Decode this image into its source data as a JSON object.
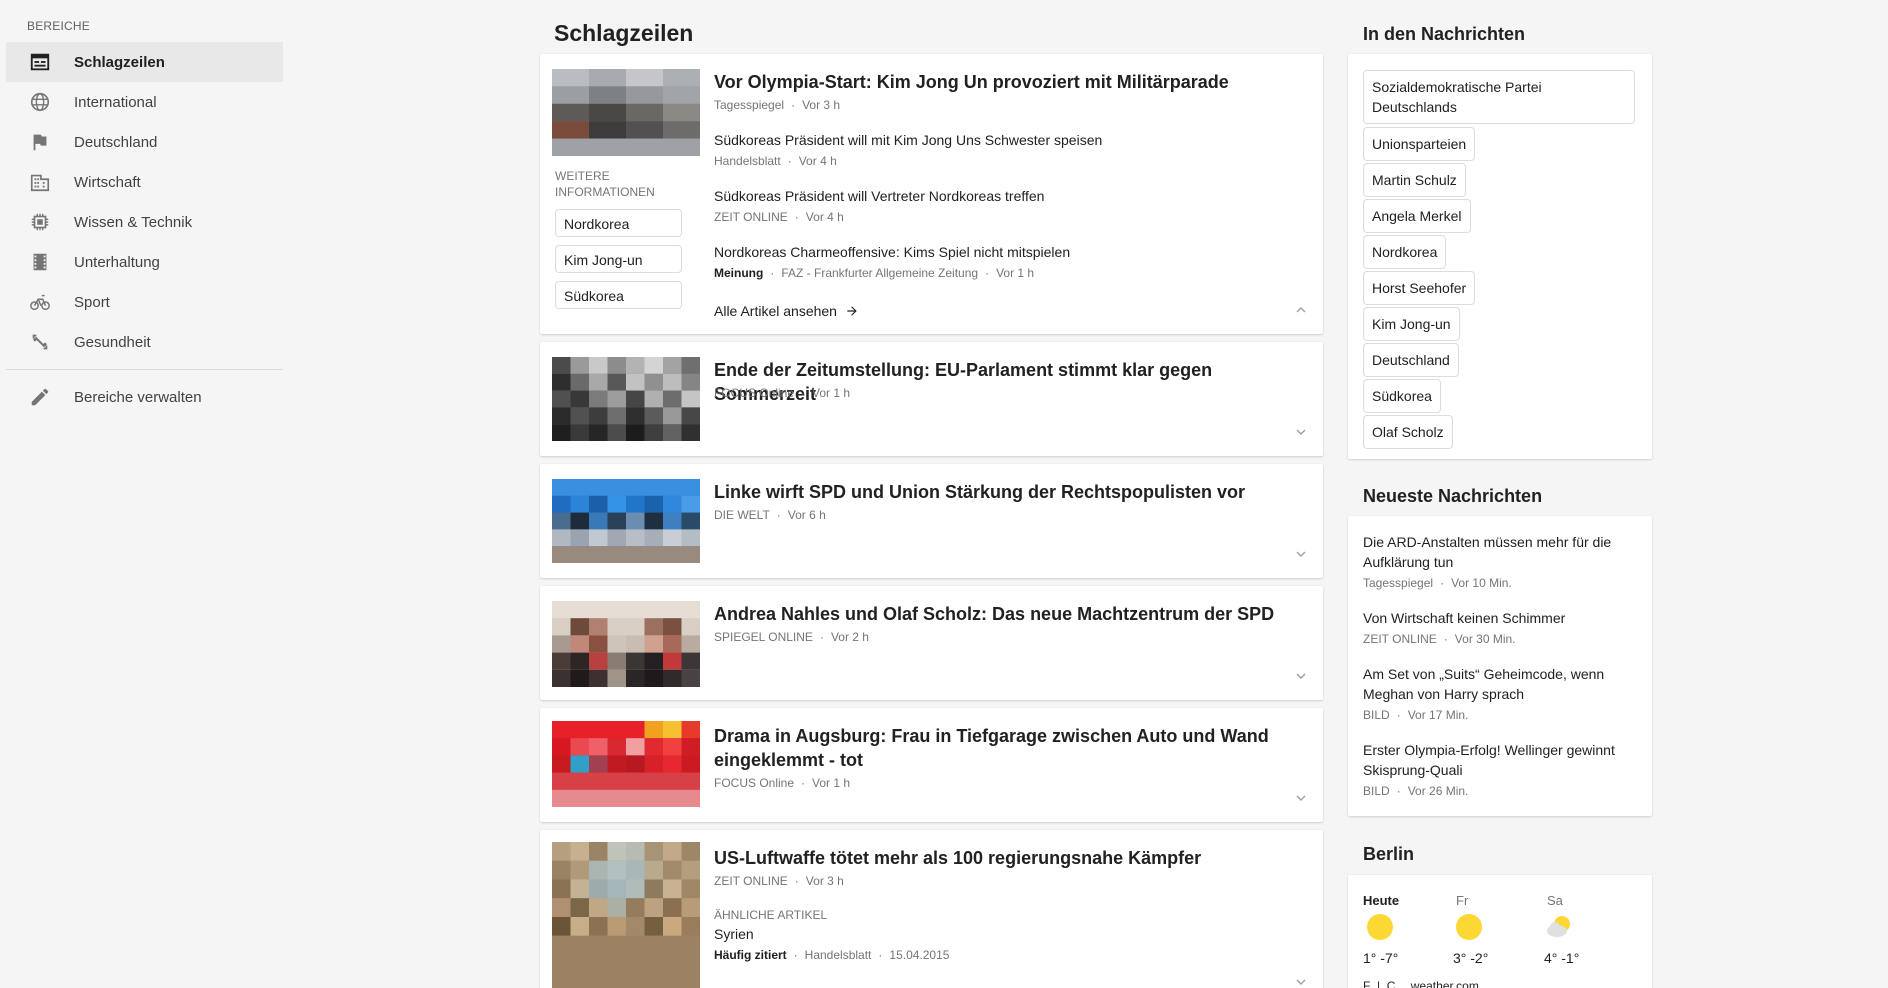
{
  "sidebar": {
    "heading": "BEREICHE",
    "items": [
      {
        "label": "Schlagzeilen",
        "icon": "newspaper-icon"
      },
      {
        "label": "International",
        "icon": "globe-icon"
      },
      {
        "label": "Deutschland",
        "icon": "flag-icon"
      },
      {
        "label": "Wirtschaft",
        "icon": "building-icon"
      },
      {
        "label": "Wissen & Technik",
        "icon": "chip-icon"
      },
      {
        "label": "Unterhaltung",
        "icon": "film-icon"
      },
      {
        "label": "Sport",
        "icon": "bicycle-icon"
      },
      {
        "label": "Gesundheit",
        "icon": "fitness-icon"
      }
    ],
    "manage": {
      "label": "Bereiche verwalten",
      "icon": "pencil-icon"
    }
  },
  "main": {
    "title": "Schlagzeilen",
    "lead": {
      "title": "Vor Olympia-Start: Kim Jong Un provoziert mit Militärparade",
      "source": "Tagesspiegel",
      "time": "Vor 3 h",
      "more_label_1": "WEITERE",
      "more_label_2": "INFORMATIONEN",
      "chips": [
        "Nordkorea",
        "Kim Jong-un",
        "Südkorea"
      ],
      "related": [
        {
          "title": "Südkoreas Präsident will mit Kim Jong Uns Schwester speisen",
          "source": "Handelsblatt",
          "time": "Vor 4 h"
        },
        {
          "title": "Südkoreas Präsident will Vertreter Nordkoreas treffen",
          "source": "ZEIT ONLINE",
          "time": "Vor 4 h"
        },
        {
          "title": "Nordkoreas Charmeoffensive: Kims Spiel nicht mitspielen",
          "tag": "Meinung",
          "source": "FAZ - Frankfurter Allgemeine Zeitung",
          "time": "Vor 1 h"
        }
      ],
      "all_articles": "Alle Artikel ansehen"
    },
    "stories": [
      {
        "title": "Ende der Zeitumstellung: EU-Parlament stimmt klar gegen Sommerzeit",
        "source": "FOCUS Online",
        "time": "Vor 1 h"
      },
      {
        "title": "Linke wirft SPD und Union Stärkung der Rechtspopulisten vor",
        "source": "DIE WELT",
        "time": "Vor 6 h"
      },
      {
        "title": "Andrea Nahles und Olaf Scholz: Das neue Machtzentrum der SPD",
        "source": "SPIEGEL ONLINE",
        "time": "Vor 2 h"
      },
      {
        "title_1": "Drama in Augsburg: Frau in Tiefgarage zwischen Auto und Wand",
        "title_2": "eingeklemmt - tot",
        "source": "FOCUS Online",
        "time": "Vor 1 h"
      },
      {
        "title": "US-Luftwaffe tötet mehr als 100 regierungsnahe Kämpfer",
        "source": "ZEIT ONLINE",
        "time": "Vor 3 h",
        "similar_label": "ÄHNLICHE ARTIKEL",
        "similar_title": "Syrien",
        "similar_tag": "Häufig zitiert",
        "similar_source": "Handelsblatt",
        "similar_time": "15.04.2015"
      }
    ]
  },
  "right": {
    "topics_heading": "In den Nachrichten",
    "topics": [
      "Sozialdemokratische Partei",
      "Deutschlands",
      "Unionsparteien",
      "Martin Schulz",
      "Angela Merkel",
      "Nordkorea",
      "Horst Seehofer",
      "Kim Jong-un",
      "Deutschland",
      "Südkorea",
      "Olaf Scholz"
    ],
    "latest_heading": "Neueste Nachrichten",
    "latest": [
      {
        "title_1": "Die ARD-Anstalten müssen mehr für die",
        "title_2": "Aufklärung tun",
        "source": "Tagesspiegel",
        "time": "Vor 10 Min."
      },
      {
        "title_1": "Von Wirtschaft keinen Schimmer",
        "title_2": "",
        "source": "ZEIT ONLINE",
        "time": "Vor 30 Min."
      },
      {
        "title_1": "Am Set von „Suits“ Geheimcode, wenn",
        "title_2": "Meghan von Harry sprach",
        "source": "BILD",
        "time": "Vor 17 Min."
      },
      {
        "title_1": "Erster Olympia-Erfolg! Wellinger gewinnt",
        "title_2": "Skisprung-Quali",
        "source": "BILD",
        "time": "Vor 26 Min."
      }
    ],
    "weather_heading": "Berlin",
    "weather": [
      {
        "day": "Heute",
        "temp": "1° -7°",
        "icon": "sun-icon"
      },
      {
        "day": "Fr",
        "temp": "3° -2°",
        "icon": "sun-icon"
      },
      {
        "day": "Sa",
        "temp": "4° -1°",
        "icon": "partly-cloudy-icon"
      }
    ],
    "weather_units": "F  |  C",
    "weather_source": "weather.com"
  },
  "colors": {
    "accent": "#212121",
    "sun": "#fdd835",
    "card": "#ffffff",
    "background": "#f5f5f5"
  }
}
